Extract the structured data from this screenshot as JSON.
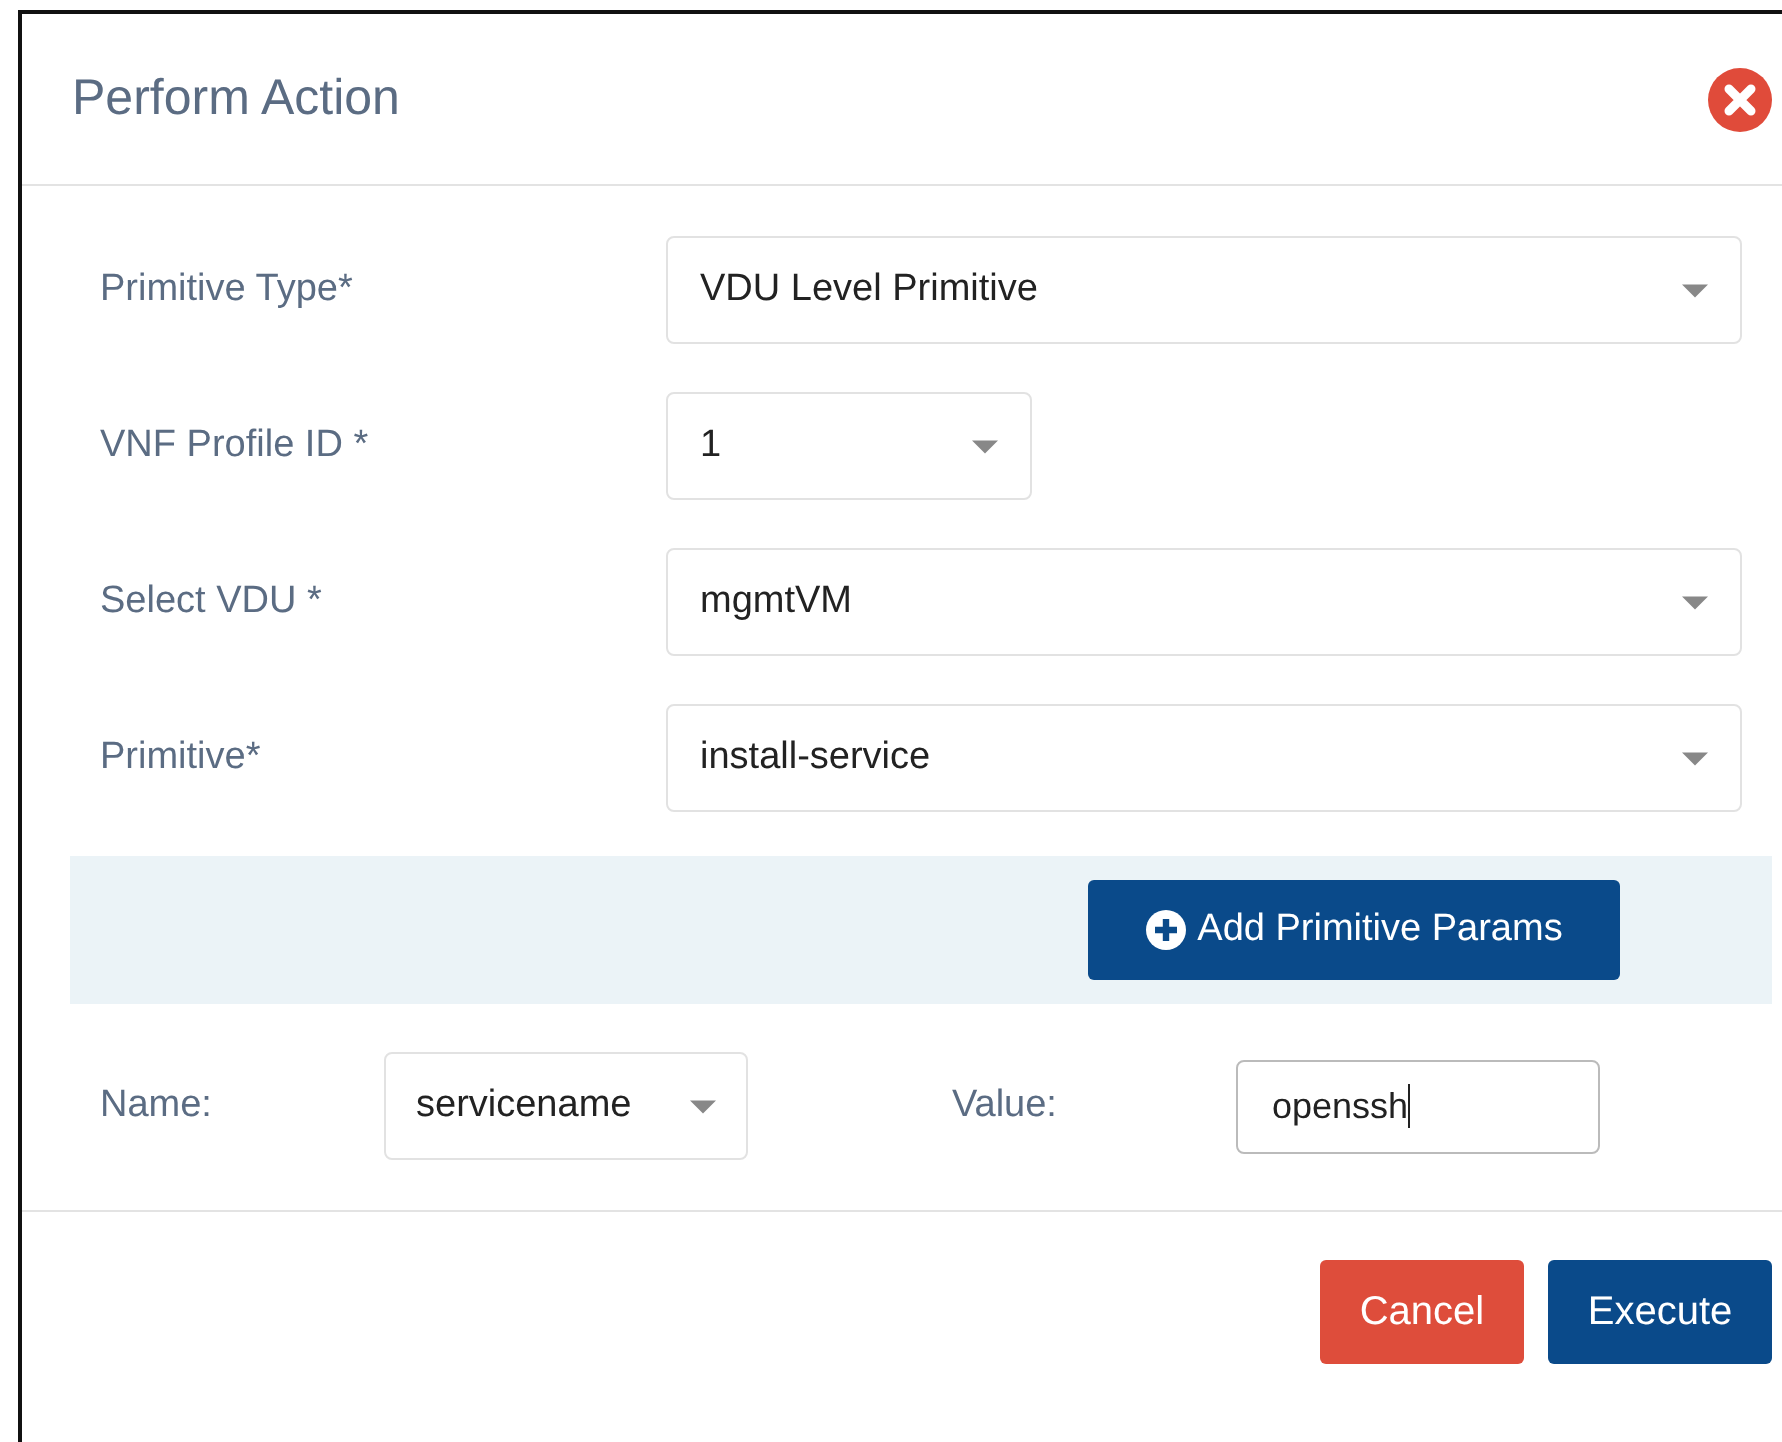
{
  "dialog": {
    "title": "Perform Action"
  },
  "fields": [
    {
      "label": "Primitive Type*",
      "value": "VDU Level Primitive",
      "kind": "dropdown"
    },
    {
      "label": "VNF Profile ID *",
      "value": "1",
      "kind": "short-dropdown"
    },
    {
      "label": "Select VDU *",
      "value": "mgmtVM",
      "kind": "dropdown"
    },
    {
      "label": "Primitive*",
      "value": "install-service",
      "kind": "dropdown"
    }
  ],
  "add_button": "Add Primitive Params",
  "param": {
    "name_label": "Name:",
    "name_value": "servicename",
    "value_label": "Value:",
    "value": "openssh"
  },
  "buttons": {
    "cancel": "Cancel",
    "execute": "Execute"
  }
}
